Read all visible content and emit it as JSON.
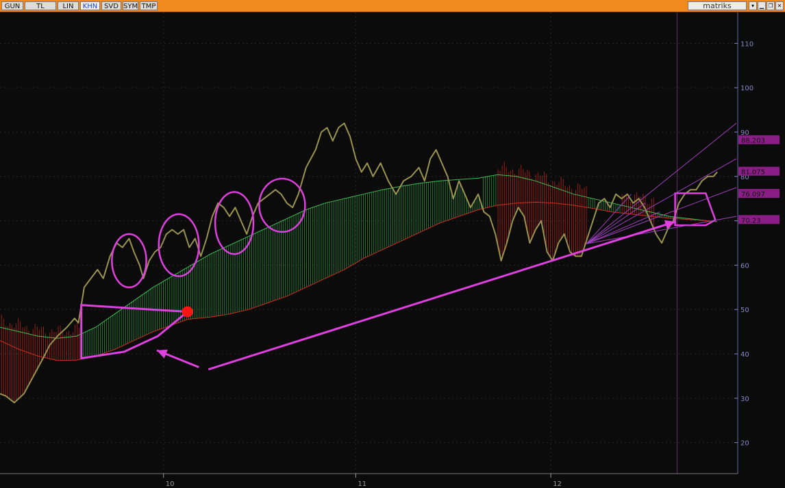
{
  "toolbar": {
    "tabs": [
      {
        "label": "GUN",
        "active": false
      },
      {
        "label": "TL",
        "active": false
      },
      {
        "label": "LIN",
        "active": false
      },
      {
        "label": "KHN",
        "active": true
      },
      {
        "label": "SVD",
        "active": false
      },
      {
        "label": "SYM",
        "active": false
      },
      {
        "label": "TMP",
        "active": false
      }
    ],
    "brand": "matriks",
    "buttons": [
      {
        "icon": "dropdown-icon",
        "glyph": "▾"
      },
      {
        "icon": "minimize-icon",
        "glyph": "▁"
      },
      {
        "icon": "restore-icon",
        "glyph": "❐"
      },
      {
        "icon": "close-icon",
        "glyph": "✕"
      }
    ]
  },
  "colors": {
    "toolbar": "#f08a1e",
    "background": "#0b0b0b",
    "price": "#9a9450",
    "up_fill": "#2fa84a",
    "down_fill": "#d42a1a",
    "annotation": "#e040e0",
    "axis_text": "#8a8ac8",
    "marker": "#ff1414"
  },
  "chart_data": {
    "type": "line",
    "y_range": [
      13,
      117
    ],
    "y_ticks": [
      110,
      100,
      90,
      80,
      70,
      60,
      50,
      40,
      30,
      20
    ],
    "x_tick_labels": [
      "10",
      "11",
      "12"
    ],
    "grid": true,
    "price_series": [
      [
        0,
        31
      ],
      [
        0.6,
        30.5
      ],
      [
        1.5,
        29
      ],
      [
        2.5,
        31
      ],
      [
        3.5,
        35
      ],
      [
        4.5,
        39
      ],
      [
        5.2,
        42
      ],
      [
        6,
        44
      ],
      [
        7,
        46
      ],
      [
        7.8,
        48
      ],
      [
        8.2,
        47
      ],
      [
        8.8,
        55
      ],
      [
        9.5,
        57
      ],
      [
        10.2,
        59
      ],
      [
        10.8,
        57
      ],
      [
        11.5,
        62
      ],
      [
        12.2,
        65
      ],
      [
        12.8,
        64
      ],
      [
        13.5,
        66
      ],
      [
        14,
        63
      ],
      [
        14.6,
        60
      ],
      [
        15,
        57
      ],
      [
        15.6,
        61
      ],
      [
        16.2,
        63
      ],
      [
        16.8,
        64
      ],
      [
        17.4,
        67
      ],
      [
        18,
        68
      ],
      [
        18.6,
        67
      ],
      [
        19.2,
        68
      ],
      [
        19.8,
        64
      ],
      [
        20.4,
        66
      ],
      [
        21,
        62
      ],
      [
        21.6,
        66
      ],
      [
        22.2,
        71
      ],
      [
        22.8,
        74
      ],
      [
        23.4,
        73
      ],
      [
        24,
        71
      ],
      [
        24.6,
        73
      ],
      [
        25.2,
        70
      ],
      [
        25.8,
        67
      ],
      [
        26.4,
        71
      ],
      [
        27,
        74
      ],
      [
        27.6,
        75
      ],
      [
        28.2,
        76
      ],
      [
        28.8,
        77
      ],
      [
        29.4,
        76
      ],
      [
        30,
        74
      ],
      [
        30.6,
        73
      ],
      [
        31.2,
        76
      ],
      [
        32,
        82
      ],
      [
        33,
        86
      ],
      [
        33.6,
        90
      ],
      [
        34.2,
        91
      ],
      [
        34.8,
        88
      ],
      [
        35.4,
        91
      ],
      [
        36,
        92
      ],
      [
        36.6,
        89
      ],
      [
        37.2,
        84
      ],
      [
        37.8,
        81
      ],
      [
        38.4,
        83
      ],
      [
        39,
        80
      ],
      [
        39.8,
        83
      ],
      [
        40.6,
        79
      ],
      [
        41.4,
        76
      ],
      [
        42.2,
        79
      ],
      [
        43,
        80
      ],
      [
        43.8,
        82
      ],
      [
        44.4,
        79
      ],
      [
        45,
        84
      ],
      [
        45.6,
        86
      ],
      [
        46.2,
        83
      ],
      [
        46.8,
        80
      ],
      [
        47.4,
        75
      ],
      [
        48,
        79
      ],
      [
        48.6,
        76
      ],
      [
        49.2,
        73
      ],
      [
        50,
        76
      ],
      [
        50.6,
        72
      ],
      [
        51.2,
        71
      ],
      [
        51.8,
        67
      ],
      [
        52.4,
        61
      ],
      [
        53,
        65
      ],
      [
        53.6,
        70
      ],
      [
        54.2,
        73
      ],
      [
        54.8,
        71
      ],
      [
        55.4,
        65
      ],
      [
        56,
        68
      ],
      [
        56.6,
        70
      ],
      [
        57.2,
        63
      ],
      [
        57.8,
        61
      ],
      [
        58.4,
        65
      ],
      [
        59,
        67
      ],
      [
        59.6,
        63
      ],
      [
        60.2,
        62
      ],
      [
        60.8,
        62
      ],
      [
        61.4,
        66
      ],
      [
        62,
        70
      ],
      [
        62.6,
        74
      ],
      [
        63.2,
        75
      ],
      [
        63.8,
        73
      ],
      [
        64.4,
        76
      ],
      [
        65,
        75
      ],
      [
        65.6,
        76
      ],
      [
        66.2,
        74
      ],
      [
        66.8,
        75
      ],
      [
        67.4,
        73
      ],
      [
        68,
        70
      ],
      [
        68.6,
        67
      ],
      [
        69.2,
        65
      ],
      [
        69.8,
        68
      ],
      [
        70.4,
        70
      ],
      [
        71,
        74
      ],
      [
        71.6,
        76
      ],
      [
        72.2,
        77
      ],
      [
        72.8,
        77
      ],
      [
        73.4,
        79
      ],
      [
        74,
        80
      ],
      [
        74.6,
        80
      ],
      [
        75,
        81
      ]
    ],
    "upper_band": [
      [
        0,
        46
      ],
      [
        2,
        45
      ],
      [
        4,
        44
      ],
      [
        6,
        43.5
      ],
      [
        8,
        44
      ],
      [
        9,
        45
      ],
      [
        10,
        46
      ],
      [
        12,
        49
      ],
      [
        14,
        52
      ],
      [
        16,
        55
      ],
      [
        18,
        57.5
      ],
      [
        20,
        60
      ],
      [
        22,
        62.5
      ],
      [
        24,
        64.5
      ],
      [
        26,
        66.5
      ],
      [
        28,
        68.5
      ],
      [
        30,
        70.5
      ],
      [
        32,
        72.5
      ],
      [
        34,
        74
      ],
      [
        36,
        75
      ],
      [
        38,
        76
      ],
      [
        40,
        77
      ],
      [
        42,
        77.8
      ],
      [
        44,
        78.5
      ],
      [
        46,
        79
      ],
      [
        48,
        79.3
      ],
      [
        50,
        79.6
      ],
      [
        52,
        80.4
      ],
      [
        54,
        80
      ],
      [
        56,
        79
      ],
      [
        58,
        77.5
      ],
      [
        60,
        76
      ],
      [
        62,
        75
      ],
      [
        64,
        74
      ],
      [
        66,
        73
      ],
      [
        68,
        72
      ],
      [
        70,
        71
      ],
      [
        72,
        70.5
      ],
      [
        74,
        70
      ],
      [
        75,
        69.8
      ]
    ],
    "lower_band": [
      [
        0,
        43
      ],
      [
        2,
        41
      ],
      [
        4,
        39.5
      ],
      [
        6,
        38.5
      ],
      [
        8,
        38.6
      ],
      [
        10,
        39.5
      ],
      [
        12,
        41
      ],
      [
        14,
        43
      ],
      [
        16,
        45
      ],
      [
        18,
        46.5
      ],
      [
        19.6,
        47.8
      ],
      [
        22,
        48.3
      ],
      [
        24,
        49
      ],
      [
        26,
        50
      ],
      [
        28,
        51.5
      ],
      [
        30,
        53
      ],
      [
        32,
        55
      ],
      [
        34,
        57
      ],
      [
        36,
        59
      ],
      [
        38,
        61.5
      ],
      [
        40,
        63.5
      ],
      [
        42,
        65.5
      ],
      [
        44,
        67.5
      ],
      [
        46,
        69.5
      ],
      [
        48,
        71
      ],
      [
        50,
        72.5
      ],
      [
        52,
        73.5
      ],
      [
        54,
        74
      ],
      [
        56,
        74.2
      ],
      [
        58,
        74
      ],
      [
        60,
        73.5
      ],
      [
        62,
        72.8
      ],
      [
        64,
        72
      ],
      [
        66,
        71.5
      ],
      [
        68,
        71
      ],
      [
        70,
        70.6
      ],
      [
        72,
        70.3
      ],
      [
        74,
        70
      ],
      [
        75,
        69.8
      ]
    ],
    "down_zones": [
      [
        0,
        8.5
      ],
      [
        52,
        61.5
      ],
      [
        65,
        68.5
      ]
    ],
    "price_tags": [
      {
        "label": "88.203",
        "value": 88.2
      },
      {
        "label": "81.075",
        "value": 81.1
      },
      {
        "label": "76.097",
        "value": 76.1
      },
      {
        "label": "70.23",
        "value": 70.2
      }
    ],
    "annotations": {
      "circles": [
        {
          "cx": 13.5,
          "cy": 61,
          "rx": 1.8,
          "ry": 6
        },
        {
          "cx": 18.7,
          "cy": 64.5,
          "rx": 2.1,
          "ry": 7
        },
        {
          "cx": 24.5,
          "cy": 69.5,
          "rx": 2.0,
          "ry": 7
        },
        {
          "cx": 29.5,
          "cy": 73.5,
          "rx": 2.4,
          "ry": 6
        }
      ],
      "red_dot": {
        "x": 19.6,
        "y": 49.5
      },
      "wedge": [
        [
          8.5,
          51
        ],
        [
          19.6,
          49.5
        ],
        [
          16.5,
          44
        ],
        [
          13,
          40.5
        ],
        [
          8.5,
          39
        ]
      ],
      "arrows": [
        {
          "from": [
            20.8,
            37
          ],
          "to": [
            16.4,
            40.8
          ]
        },
        {
          "from": [
            21.8,
            36.5
          ],
          "to": [
            70.6,
            69.8
          ]
        }
      ],
      "fan_origin": [
        61.3,
        64.8
      ],
      "fan_targets": [
        [
          77,
          92
        ],
        [
          77,
          84
        ],
        [
          77,
          77.5
        ],
        [
          77,
          71
        ],
        [
          66,
          76
        ],
        [
          67.5,
          74
        ],
        [
          69,
          72
        ]
      ],
      "box": [
        [
          70.6,
          69
        ],
        [
          73.8,
          69
        ],
        [
          74.8,
          70.2
        ],
        [
          73.8,
          76.2
        ],
        [
          70.6,
          76.2
        ]
      ]
    }
  }
}
